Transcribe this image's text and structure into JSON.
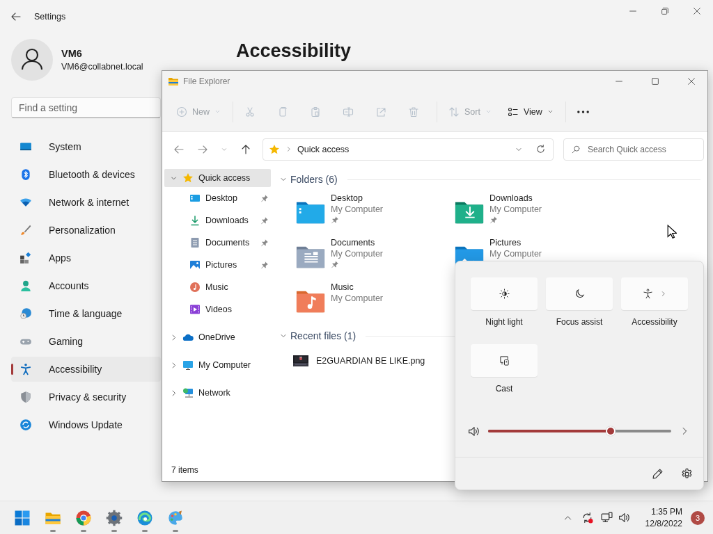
{
  "settings": {
    "title": "Settings",
    "user": {
      "name": "VM6",
      "email": "VM6@collabnet.local"
    },
    "search": {
      "placeholder": "Find a setting"
    },
    "page_title": "Accessibility",
    "nav": [
      {
        "label": "System",
        "kind": "system",
        "selected": false
      },
      {
        "label": "Bluetooth & devices",
        "kind": "bluetooth",
        "selected": false
      },
      {
        "label": "Network & internet",
        "kind": "network",
        "selected": false
      },
      {
        "label": "Personalization",
        "kind": "personalization",
        "selected": false
      },
      {
        "label": "Apps",
        "kind": "apps",
        "selected": false
      },
      {
        "label": "Accounts",
        "kind": "accounts",
        "selected": false
      },
      {
        "label": "Time & language",
        "kind": "time",
        "selected": false
      },
      {
        "label": "Gaming",
        "kind": "gaming",
        "selected": false
      },
      {
        "label": "Accessibility",
        "kind": "accessibility",
        "selected": true
      },
      {
        "label": "Privacy & security",
        "kind": "privacy",
        "selected": false
      },
      {
        "label": "Windows Update",
        "kind": "update",
        "selected": false
      }
    ]
  },
  "explorer": {
    "title": "File Explorer",
    "toolbar": [
      {
        "kind": "new",
        "label": "New",
        "disabled": true
      },
      {
        "kind": "cut",
        "disabled": true
      },
      {
        "kind": "copy",
        "disabled": true
      },
      {
        "kind": "paste",
        "disabled": true
      },
      {
        "kind": "rename",
        "disabled": true
      },
      {
        "kind": "share",
        "disabled": true
      },
      {
        "kind": "delete",
        "disabled": true
      },
      {
        "kind": "sort",
        "label": "Sort",
        "disabled": true
      },
      {
        "kind": "view",
        "label": "View",
        "disabled": false
      },
      {
        "kind": "more",
        "disabled": false
      }
    ],
    "address": {
      "location": "Quick access"
    },
    "search": {
      "placeholder": "Search Quick access"
    },
    "nav_tree": [
      {
        "label": "Quick access",
        "kind": "star",
        "expanded": true,
        "selected": true,
        "children": [
          {
            "label": "Desktop",
            "kind": "desktop",
            "pinned": true,
            "selected": false
          },
          {
            "label": "Downloads",
            "kind": "downloads",
            "pinned": true,
            "selected": false
          },
          {
            "label": "Documents",
            "kind": "documents",
            "pinned": true,
            "selected": false
          },
          {
            "label": "Pictures",
            "kind": "pictures",
            "pinned": true,
            "selected": false
          },
          {
            "label": "Music",
            "kind": "music",
            "pinned": false,
            "selected": false
          },
          {
            "label": "Videos",
            "kind": "videos",
            "pinned": false,
            "selected": false
          }
        ]
      },
      {
        "label": "OneDrive",
        "kind": "cloud",
        "expanded": false,
        "selected": false
      },
      {
        "label": "My Computer",
        "kind": "computer",
        "expanded": false,
        "selected": false
      },
      {
        "label": "Network",
        "kind": "network",
        "expanded": false,
        "selected": false
      }
    ],
    "sections": [
      {
        "title": "Folders (6)",
        "kind": "folders",
        "expanded": true,
        "items": [
          {
            "name": "Desktop",
            "location": "My Computer",
            "kind": "desktop",
            "pinned": true
          },
          {
            "name": "Downloads",
            "location": "My Computer",
            "kind": "downloads",
            "pinned": true
          },
          {
            "name": "Documents",
            "location": "My Computer",
            "kind": "documents",
            "pinned": true
          },
          {
            "name": "Pictures",
            "location": "My Computer",
            "kind": "pictures"
          },
          {
            "name": "Music",
            "location": "My Computer",
            "kind": "music",
            "pinned": false
          }
        ]
      },
      {
        "title": "Recent files (1)",
        "kind": "files",
        "expanded": true,
        "items": [
          {
            "name": "E2GUARDIAN BE LIKE.png",
            "kind": "picture"
          }
        ]
      }
    ],
    "status": "7 items"
  },
  "quick_settings": {
    "tiles": [
      {
        "label": "Night light",
        "kind": "night-light",
        "on": false,
        "more": false
      },
      {
        "label": "Focus assist",
        "kind": "focus",
        "on": false,
        "more": false
      },
      {
        "label": "Accessibility",
        "kind": "accessibility",
        "on": false,
        "more": true
      },
      {
        "label": "Cast",
        "kind": "cast",
        "on": false,
        "more": false
      }
    ],
    "volume": {
      "level": 0.67
    }
  },
  "taskbar": {
    "apps": [
      {
        "kind": "start",
        "running": false
      },
      {
        "kind": "explorer",
        "running": true
      },
      {
        "kind": "chrome",
        "running": true
      },
      {
        "kind": "settings",
        "running": true
      },
      {
        "kind": "edge",
        "running": true
      },
      {
        "kind": "paint",
        "running": true
      }
    ],
    "time": "1:35 PM",
    "date": "12/8/2022",
    "notifications": "3"
  }
}
